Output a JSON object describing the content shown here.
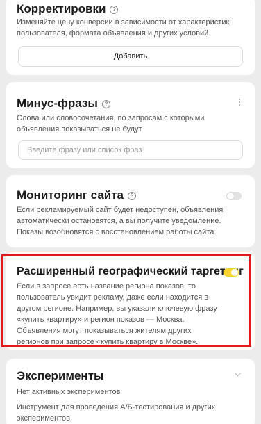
{
  "corrections": {
    "title": "Корректировки",
    "desc": "Изменяйте цену конверсии в зависимости от характеристик пользователя, формата объявления и других условий.",
    "add_button": "Добавить"
  },
  "negative": {
    "title": "Минус-фразы",
    "desc": "Слова или словосочетания, по запросам с которыми объявления показываться не будут",
    "placeholder": "Введите фразу или список фраз"
  },
  "monitoring": {
    "title": "Мониторинг сайта",
    "desc": "Если рекламируемый сайт будет недоступен, объявления автоматически остановятся, а вы получите уведомление. Показы возобновятся с восстановлением работы сайта.",
    "toggle_on": false
  },
  "geo": {
    "title": "Расширенный географический таргетинг",
    "desc": "Если в запросе есть название региона показов, то пользователь увидит рекламу, даже если находится в другом регионе. Например, вы указали ключевую фразу «купить квартиру» и регион показов — Москва. Объявления могут показываться жителям других регионов при запросе «купить квартиру в Москве».",
    "toggle_on": true
  },
  "experiments": {
    "title": "Эксперименты",
    "status": "Нет активных экспериментов",
    "desc": "Инструмент для проведения А/Б-тестирования и других экспериментов."
  },
  "help_glyph": "?",
  "colors": {
    "toggle_active": "#f6d42b",
    "highlight": "#e01b1b",
    "background": "#ececec"
  }
}
